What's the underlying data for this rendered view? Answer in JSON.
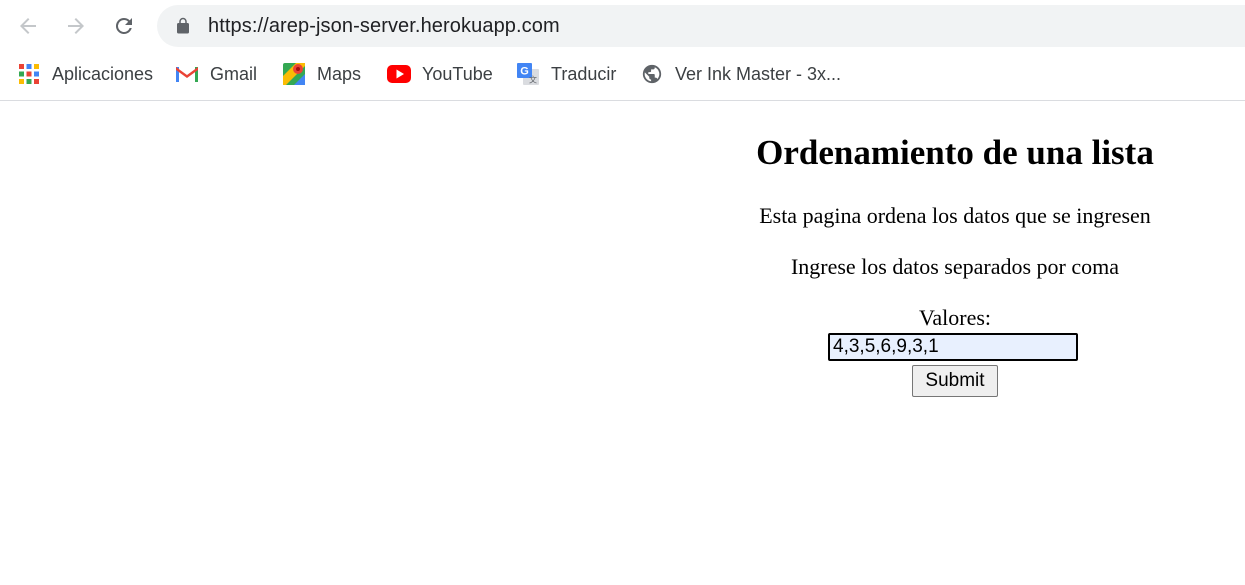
{
  "browser": {
    "url": "https://arep-json-server.herokuapp.com",
    "bookmarks": [
      {
        "label": "Aplicaciones",
        "icon": "apps-grid-icon"
      },
      {
        "label": "Gmail",
        "icon": "gmail-icon"
      },
      {
        "label": "Maps",
        "icon": "maps-icon"
      },
      {
        "label": "YouTube",
        "icon": "youtube-icon"
      },
      {
        "label": "Traducir",
        "icon": "translate-icon"
      },
      {
        "label": "Ver Ink Master - 3x...",
        "icon": "globe-icon"
      }
    ]
  },
  "page": {
    "title": "Ordenamiento de una lista",
    "description": "Esta pagina ordena los datos que se ingresen",
    "instruction": "Ingrese los datos separados por coma",
    "form": {
      "label": "Valores:",
      "input_value": "4,3,5,6,9,3,1",
      "submit_label": "Submit"
    }
  },
  "colors": {
    "omnibox_bg": "#f1f3f4",
    "input_autofill_bg": "#e8f0fe",
    "youtube_red": "#ff0000",
    "gmail_red": "#ea4335"
  }
}
